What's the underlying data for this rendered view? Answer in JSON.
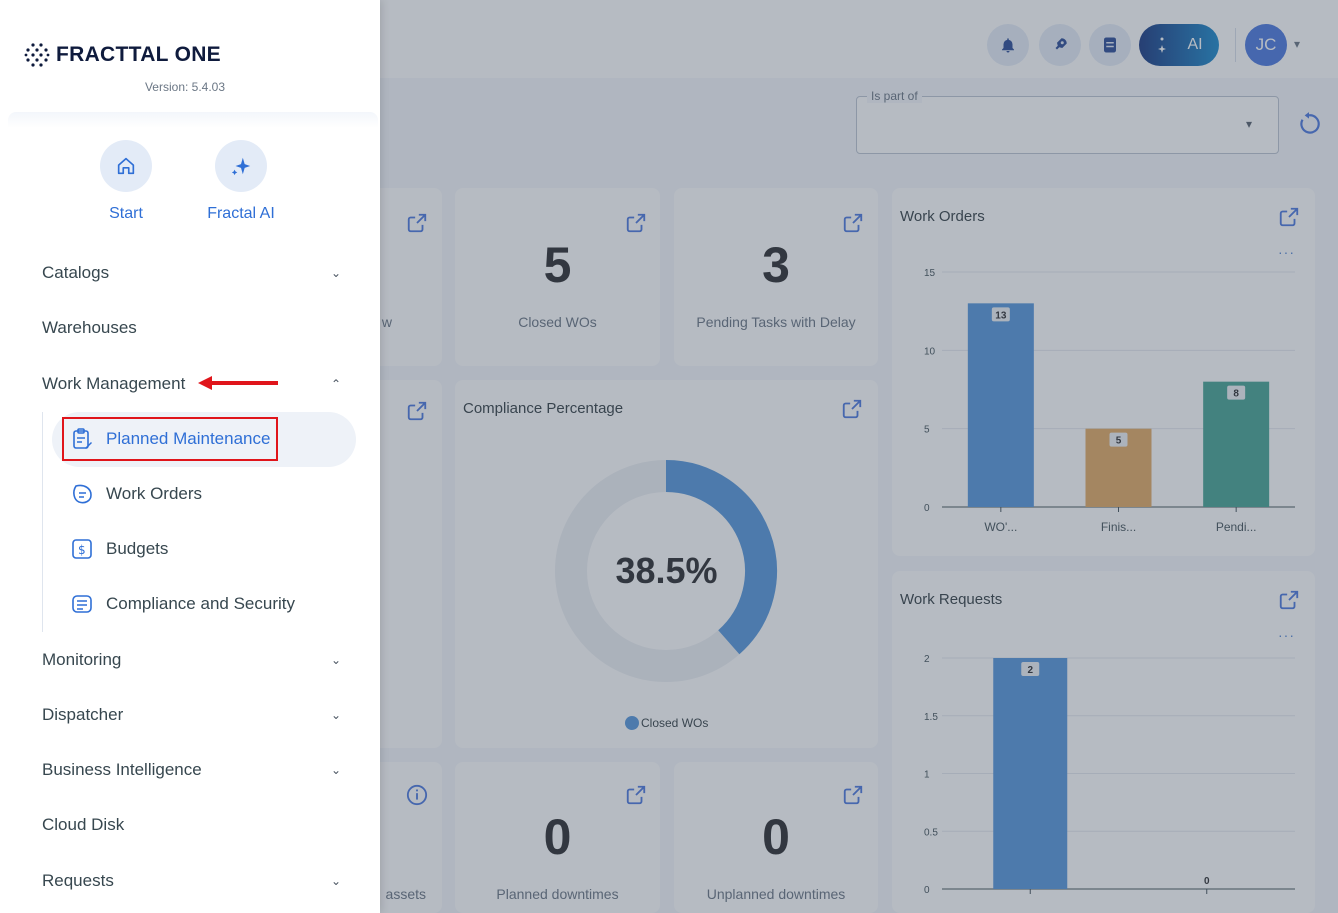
{
  "app": {
    "brand": "FRACTTAL ONE",
    "version": "Version: 5.4.03"
  },
  "topbar": {
    "ai_label": "AI",
    "user_initials": "JC"
  },
  "filter": {
    "label": "Is part of",
    "value": ""
  },
  "quick_access": [
    {
      "label": "Start",
      "icon": "home-icon"
    },
    {
      "label": "Fractal AI",
      "icon": "sparkle-icon"
    }
  ],
  "menu": {
    "catalogs": "Catalogs",
    "warehouses": "Warehouses",
    "work_management": "Work Management",
    "sub": [
      {
        "label": "Planned Maintenance",
        "icon": "clipboard-edit-icon",
        "active": true
      },
      {
        "label": "Work Orders",
        "icon": "work-orders-icon"
      },
      {
        "label": "Budgets",
        "icon": "budget-icon"
      },
      {
        "label": "Compliance and Security",
        "icon": "checklist-icon"
      }
    ],
    "monitoring": "Monitoring",
    "dispatcher": "Dispatcher",
    "business_intelligence": "Business Intelligence",
    "cloud_disk": "Cloud Disk",
    "requests": "Requests"
  },
  "kpis": {
    "partial_left_top": "w",
    "closed_wos": {
      "value": "5",
      "label": "Closed WOs"
    },
    "pending_tasks": {
      "value": "3",
      "label": "Pending Tasks with Delay"
    },
    "partial_left_bottom": "assets",
    "planned_downtimes": {
      "value": "0",
      "label": "Planned downtimes"
    },
    "unplanned_downtimes": {
      "value": "0",
      "label": "Unplanned downtimes"
    }
  },
  "compliance": {
    "title": "Compliance Percentage",
    "value_text": "38.5%",
    "legend": "Closed WOs"
  },
  "work_orders_chart_title": "Work Orders",
  "work_requests_chart_title": "Work Requests",
  "colors": {
    "accent": "#2f6fd6",
    "bar_blue": "#4a90d9",
    "bar_orange": "#e0a458",
    "bar_teal": "#3a9e8c",
    "highlight": "#e0151b"
  },
  "chart_data": [
    {
      "type": "bar",
      "title": "Work Orders",
      "categories": [
        "WO'...",
        "Finis...",
        "Pendi..."
      ],
      "values": [
        13,
        5,
        8
      ],
      "yticks": [
        0,
        5,
        10,
        15
      ],
      "ylim": [
        0,
        15
      ]
    },
    {
      "type": "bar",
      "title": "Work Requests",
      "categories": [
        "",
        ""
      ],
      "values": [
        2,
        0
      ],
      "yticks": [
        0,
        0.5,
        1,
        1.5,
        2
      ],
      "ylim": [
        0,
        2
      ]
    },
    {
      "type": "pie",
      "title": "Compliance Percentage",
      "categories": [
        "Closed WOs"
      ],
      "values": [
        38.5
      ]
    }
  ]
}
